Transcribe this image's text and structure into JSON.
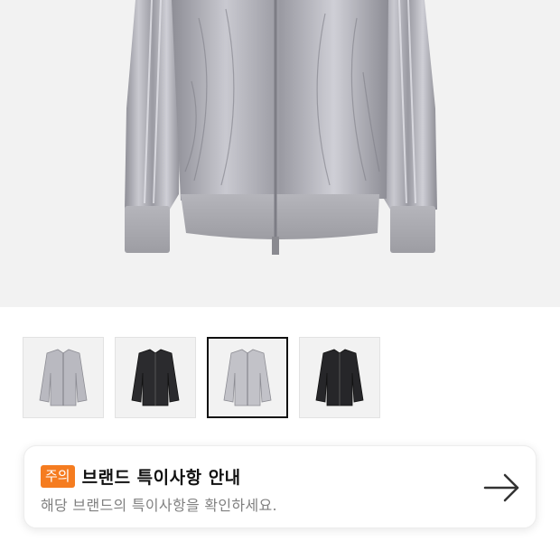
{
  "gallery": {
    "thumbnails": [
      {
        "color": "silver",
        "selected": false
      },
      {
        "color": "black",
        "selected": false
      },
      {
        "color": "silver",
        "selected": true
      },
      {
        "color": "black",
        "selected": false
      }
    ]
  },
  "notice": {
    "badge": "주의",
    "title": "브랜드 특이사항 안내",
    "subtitle": "해당 브랜드의 특이사항을 확인하세요.",
    "badge_color": "#f57c20",
    "arrow_icon": "arrow-right-icon"
  }
}
